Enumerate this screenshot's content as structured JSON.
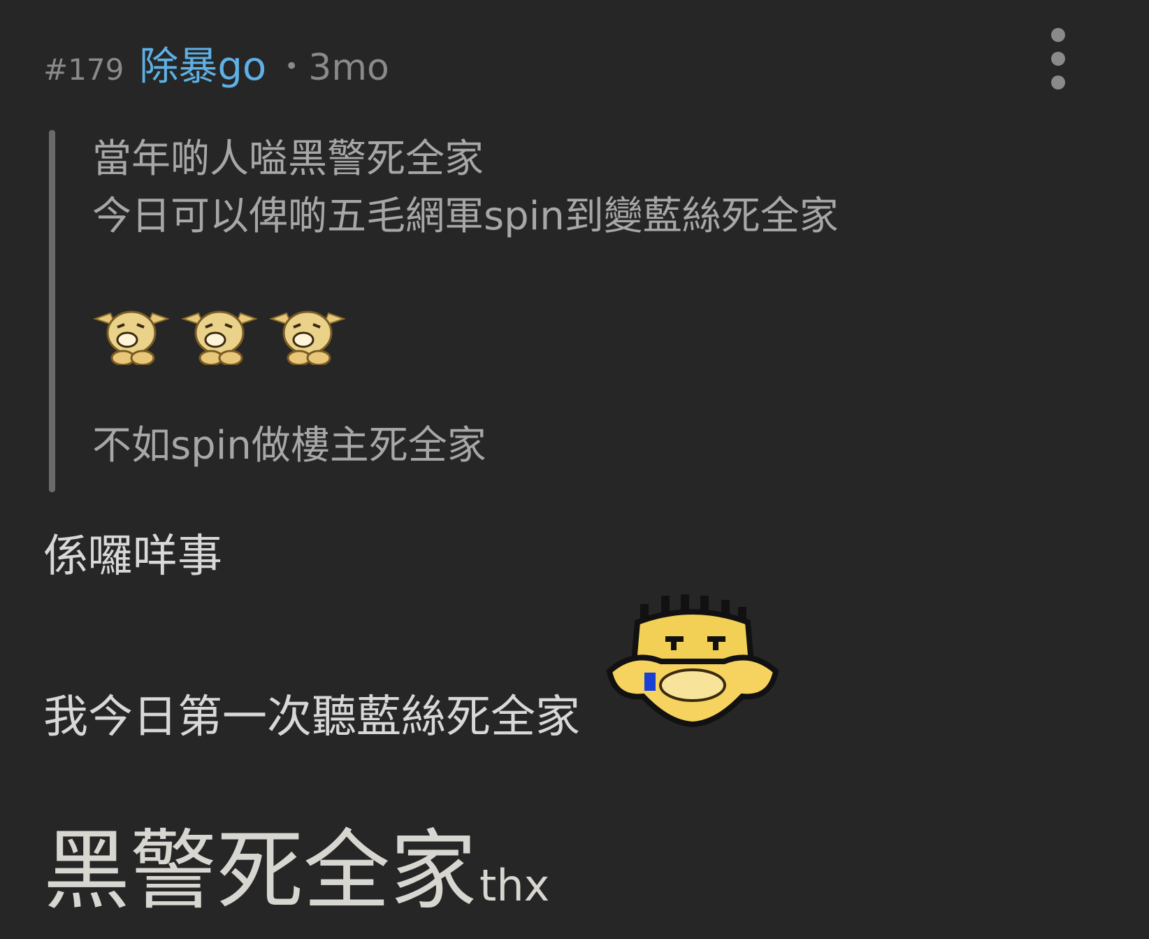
{
  "post": {
    "number": "#179",
    "username": "除暴go",
    "separator": "•",
    "time": "3mo"
  },
  "quote": {
    "line1": "當年啲人嗌黑警死全家",
    "line2": "今日可以俾啲五毛網軍spin到變藍絲死全家",
    "emojis": [
      "dog-laugh-icon",
      "dog-laugh-icon",
      "dog-laugh-icon"
    ],
    "line3": "不如spin做樓主死全家"
  },
  "body": {
    "line1": "係囉咩事",
    "line2": "我今日第一次聽藍絲死全家",
    "emoji": "psyduck-icon",
    "big_text": "黑警死全家",
    "small_text": "thx"
  },
  "colors": {
    "background": "#262626",
    "username": "#5eb0e5",
    "meta": "#8a8a8a",
    "quote_text": "#a7a7a7",
    "body_text": "#d8d8d8"
  }
}
